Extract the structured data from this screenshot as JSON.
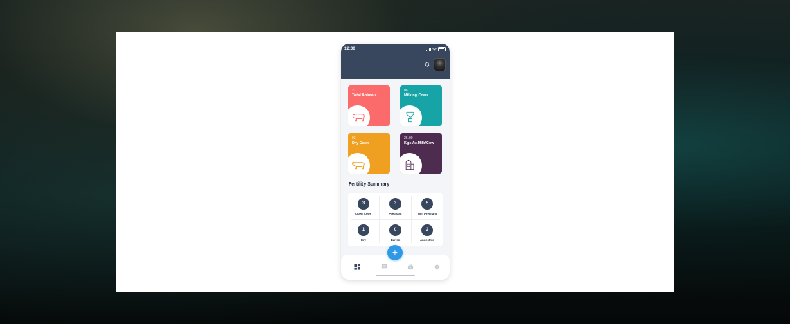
{
  "status_bar": {
    "time": "12:00"
  },
  "header": {
    "menu_icon": "hamburger-icon",
    "bell_icon": "bell-icon",
    "avatar": "user-avatar"
  },
  "tiles": [
    {
      "value": "27",
      "label": "Total Animals",
      "color": "#fb6b6b",
      "icon": "cow-icon"
    },
    {
      "value": "06",
      "label": "Milking Cows",
      "color": "#17a4a7",
      "icon": "milking-machine-icon"
    },
    {
      "value": "02",
      "label": "Dry Cows",
      "color": "#f0a020",
      "icon": "cow-icon"
    },
    {
      "value": "26.00",
      "label": "Kgs Av.Milk/Cow",
      "color": "#4e2c50",
      "icon": "milk-carton-icon"
    }
  ],
  "fertility": {
    "title": "Fertility Summary",
    "items": [
      {
        "count": "3",
        "label": "Open Cows"
      },
      {
        "count": "3",
        "label": "Pregnant"
      },
      {
        "count": "5",
        "label": "Non Pregnant"
      },
      {
        "count": "1",
        "label": "Dry"
      },
      {
        "count": "0",
        "label": "Barren"
      },
      {
        "count": "2",
        "label": "Anoestrus"
      }
    ]
  },
  "fab": {
    "label": "+"
  },
  "bottom_nav": [
    {
      "icon": "dashboard-icon",
      "active": true
    },
    {
      "icon": "chat-icon",
      "active": false
    },
    {
      "icon": "briefcase-icon",
      "active": false
    },
    {
      "icon": "settings-icon",
      "active": false
    }
  ],
  "colors": {
    "header": "#38465e",
    "accent": "#2f99e8"
  }
}
